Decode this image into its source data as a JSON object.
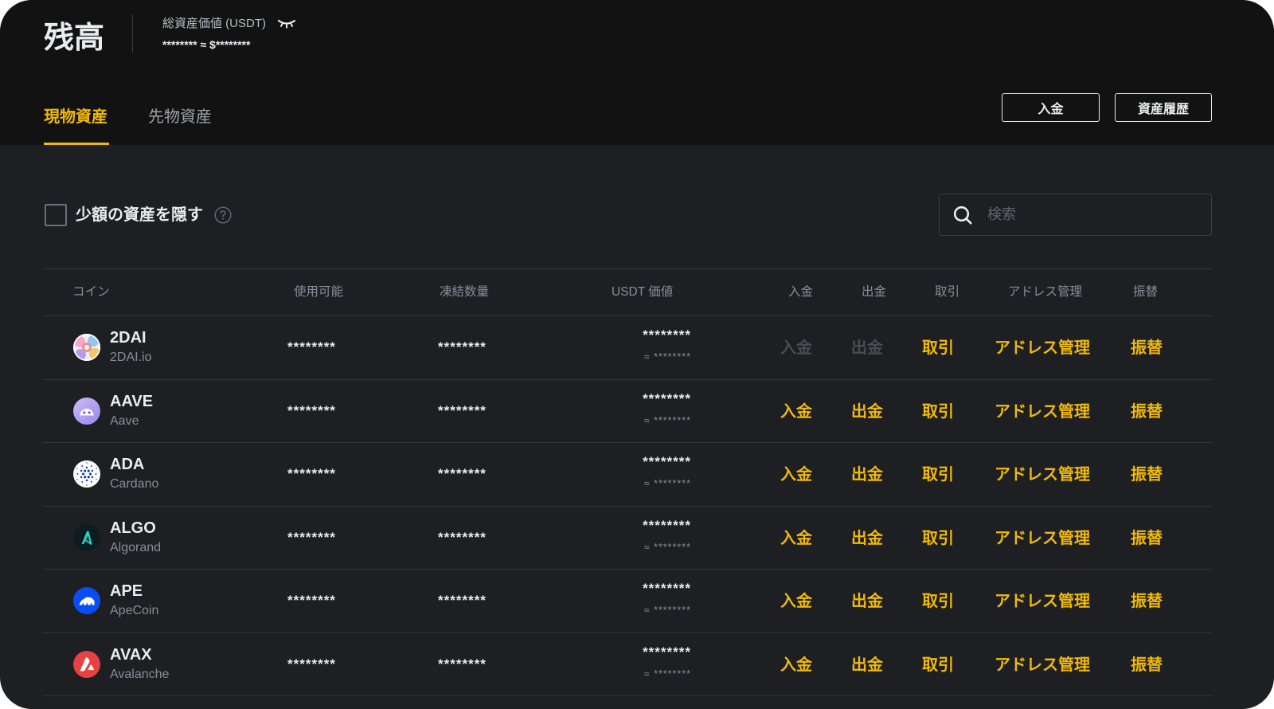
{
  "colors": {
    "accent": "#f0b90b",
    "header_background": "#121212",
    "page_background": "#1e1f22",
    "text_primary": "#eaecef",
    "text_muted": "#848e9c",
    "text_disabled": "#474d57",
    "divider": "#34363a"
  },
  "header": {
    "title": "残高",
    "total_label": "総資産価値 (USDT)",
    "total_value": "******** ≈ $********",
    "visibility_icon": "eye-closed-icon"
  },
  "tabs": [
    {
      "label": "現物資産",
      "active": true
    },
    {
      "label": "先物資産",
      "active": false
    }
  ],
  "toolbar": {
    "deposit_label": "入金",
    "history_label": "資産履歴"
  },
  "filter": {
    "hide_small_label": "少額の資産を隠す",
    "hide_small_checked": false,
    "help_icon": "question-circle-icon"
  },
  "search": {
    "placeholder": "検索",
    "icon": "search-icon"
  },
  "table": {
    "columns": [
      "コイン",
      "使用可能",
      "凍結数量",
      "USDT 価値",
      "入金",
      "出金",
      "取引",
      "アドレス管理",
      "振替"
    ],
    "rows": [
      {
        "symbol": "2DAI",
        "name": "2DAI.io",
        "icon": "2dai-logo-icon",
        "available": "********",
        "frozen": "********",
        "usdt_value": "********",
        "usdt_approx": "≈ ********",
        "actions": {
          "deposit": "入金",
          "withdraw": "出金",
          "trade": "取引",
          "address": "アドレス管理",
          "transfer": "振替"
        },
        "deposit_enabled": false,
        "withdraw_enabled": false
      },
      {
        "symbol": "AAVE",
        "name": "Aave",
        "icon": "aave-logo-icon",
        "available": "********",
        "frozen": "********",
        "usdt_value": "********",
        "usdt_approx": "≈ ********",
        "actions": {
          "deposit": "入金",
          "withdraw": "出金",
          "trade": "取引",
          "address": "アドレス管理",
          "transfer": "振替"
        },
        "deposit_enabled": true,
        "withdraw_enabled": true
      },
      {
        "symbol": "ADA",
        "name": "Cardano",
        "icon": "cardano-logo-icon",
        "available": "********",
        "frozen": "********",
        "usdt_value": "********",
        "usdt_approx": "≈ ********",
        "actions": {
          "deposit": "入金",
          "withdraw": "出金",
          "trade": "取引",
          "address": "アドレス管理",
          "transfer": "振替"
        },
        "deposit_enabled": true,
        "withdraw_enabled": true
      },
      {
        "symbol": "ALGO",
        "name": "Algorand",
        "icon": "algorand-logo-icon",
        "available": "********",
        "frozen": "********",
        "usdt_value": "********",
        "usdt_approx": "≈ ********",
        "actions": {
          "deposit": "入金",
          "withdraw": "出金",
          "trade": "取引",
          "address": "アドレス管理",
          "transfer": "振替"
        },
        "deposit_enabled": true,
        "withdraw_enabled": true
      },
      {
        "symbol": "APE",
        "name": "ApeCoin",
        "icon": "apecoin-logo-icon",
        "available": "********",
        "frozen": "********",
        "usdt_value": "********",
        "usdt_approx": "≈ ********",
        "actions": {
          "deposit": "入金",
          "withdraw": "出金",
          "trade": "取引",
          "address": "アドレス管理",
          "transfer": "振替"
        },
        "deposit_enabled": true,
        "withdraw_enabled": true
      },
      {
        "symbol": "AVAX",
        "name": "Avalanche",
        "icon": "avalanche-logo-icon",
        "available": "********",
        "frozen": "********",
        "usdt_value": "********",
        "usdt_approx": "≈ ********",
        "actions": {
          "deposit": "入金",
          "withdraw": "出金",
          "trade": "取引",
          "address": "アドレス管理",
          "transfer": "振替"
        },
        "deposit_enabled": true,
        "withdraw_enabled": true
      }
    ]
  }
}
